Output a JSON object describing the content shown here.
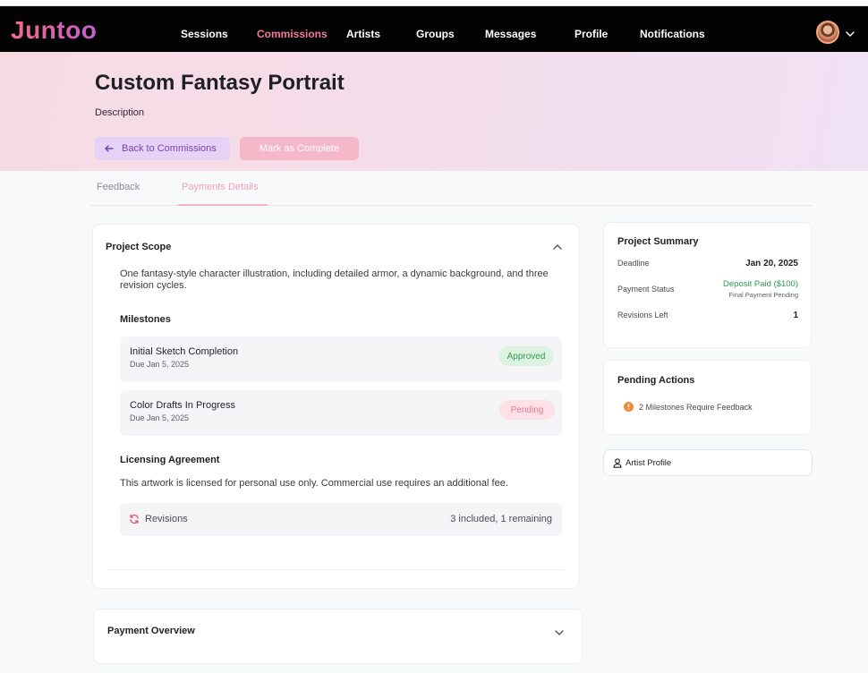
{
  "brand": {
    "name": "Juntoo"
  },
  "nav": {
    "sessions": "Sessions",
    "commissions": "Commissions",
    "artists": "Artists",
    "groups": "Groups",
    "messages": "Messages",
    "profile": "Profile",
    "notifications": "Notifications"
  },
  "hero": {
    "title": "Custom Fantasy Portrait",
    "description": "Description",
    "back_label": "Back to Commissions",
    "complete_label": "Mark as Complete"
  },
  "tabs": {
    "feedback": "Feedback",
    "payments": "Payments Details"
  },
  "scope": {
    "title": "Project Scope",
    "description": "One fantasy-style character illustration, including detailed armor, a dynamic background, and three revision cycles.",
    "milestones_heading": "Milestones",
    "milestones": [
      {
        "name": "Initial Sketch Completion",
        "due": "Due Jan 5, 2025",
        "status": "Approved"
      },
      {
        "name": "Color Drafts In Progress",
        "due": "Due Jan 5, 2025",
        "status": "Pending"
      }
    ],
    "licensing_heading": "Licensing Agreement",
    "licensing_text": "This artwork is licensed for personal use only. Commercial use requires an additional fee.",
    "revisions_label": "Revisions",
    "revisions_value": "3 included, 1 remaining"
  },
  "payment_overview": {
    "title": "Payment Overview"
  },
  "summary": {
    "title": "Project Summary",
    "deadline_label": "Deadline",
    "deadline_value": "Jan 20, 2025",
    "payment_status_label": "Payment Status",
    "payment_status_value": "Deposit Paid ($100)",
    "payment_status_note": "Final Payment Pending",
    "revisions_left_label": "Revisions Left",
    "revisions_left_value": "1"
  },
  "pending": {
    "title": "Pending Actions",
    "item": "2 Milestones Require Feedback"
  },
  "artist_profile": {
    "label": "Artist Profile"
  },
  "colors": {
    "brand_start": "#f06a86",
    "brand_end": "#c45fd0",
    "nav_active": "#f1789a",
    "approved": "#2f9a52",
    "pending": "#e57792",
    "deposit": "#2f9a52",
    "warning": "#ef8a3a"
  },
  "icons": {
    "back": "arrow-left-icon",
    "collapse": "chevron-up-icon",
    "expand": "chevron-down-icon",
    "revisions": "refresh-icon",
    "warning": "alert-circle-icon",
    "artist": "user-icon"
  }
}
